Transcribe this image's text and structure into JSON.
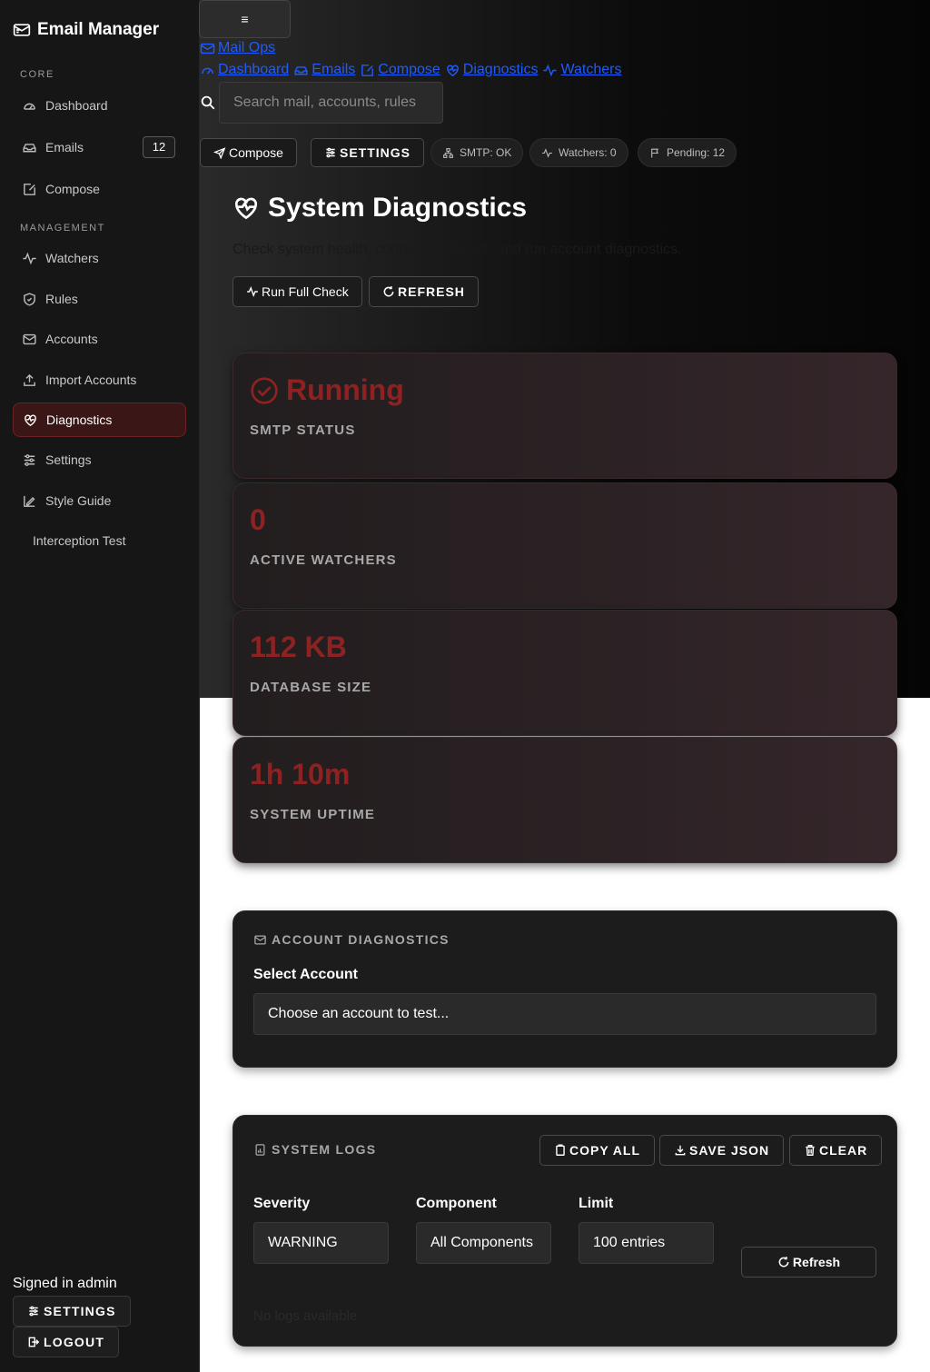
{
  "colors": {
    "accent": "#8e2222",
    "link": "#1f5bff",
    "sidebar_bg": "#161616"
  },
  "sidebar": {
    "brand": "Email Manager",
    "sections": {
      "core": "CORE",
      "management": "MANAGEMENT"
    },
    "items": [
      {
        "label": "Dashboard",
        "icon": "gauge-icon"
      },
      {
        "label": "Emails",
        "icon": "inbox-icon",
        "badge": "12"
      },
      {
        "label": "Compose",
        "icon": "edit-icon"
      },
      {
        "label": "Watchers",
        "icon": "activity-icon"
      },
      {
        "label": "Rules",
        "icon": "shield-icon"
      },
      {
        "label": "Accounts",
        "icon": "mail-accounts-icon"
      },
      {
        "label": "Import Accounts",
        "icon": "upload-icon"
      },
      {
        "label": "Diagnostics",
        "icon": "heart-pulse-icon",
        "active": true
      },
      {
        "label": "Settings",
        "icon": "sliders-icon"
      },
      {
        "label": "Style Guide",
        "icon": "brush-icon"
      },
      {
        "label": "Interception Test"
      }
    ],
    "signed_in": "Signed in admin",
    "settings_label": "SETTINGS",
    "logout_label": "LOGOUT"
  },
  "topbar": {
    "menu_glyph": "≡",
    "brand_link": "Mail Ops",
    "breadcrumbs": [
      "Dashboard",
      "Emails",
      "Compose",
      "Diagnostics",
      "Watchers"
    ],
    "search_placeholder": "Search mail, accounts, rules",
    "compose_label": "Compose",
    "settings_label": "SETTINGS",
    "pills": [
      "SMTP: OK",
      "Watchers: 0",
      "Pending: 12"
    ]
  },
  "page": {
    "title": "System Diagnostics",
    "subtitle": "Check system health, connection status, and run account diagnostics.",
    "run_check_label": "Run Full Check",
    "refresh_label": "REFRESH"
  },
  "stats": [
    {
      "value": "Running",
      "label": "SMTP STATUS"
    },
    {
      "value": "0",
      "label": "ACTIVE WATCHERS"
    },
    {
      "value": "112 KB",
      "label": "DATABASE SIZE"
    },
    {
      "value": "1h 10m",
      "label": "SYSTEM UPTIME"
    }
  ],
  "account_diag": {
    "title": "ACCOUNT DIAGNOSTICS",
    "select_label": "Select Account",
    "select_value": "Choose an account to test..."
  },
  "logs": {
    "title": "SYSTEM LOGS",
    "copy_label": "COPY ALL",
    "save_label": "SAVE JSON",
    "clear_label": "CLEAR",
    "severity_label": "Severity",
    "severity_value": "WARNING",
    "component_label": "Component",
    "component_value": "All Components",
    "limit_label": "Limit",
    "limit_value": "100 entries",
    "refresh_label": "Refresh",
    "empty_text": "No logs available"
  }
}
